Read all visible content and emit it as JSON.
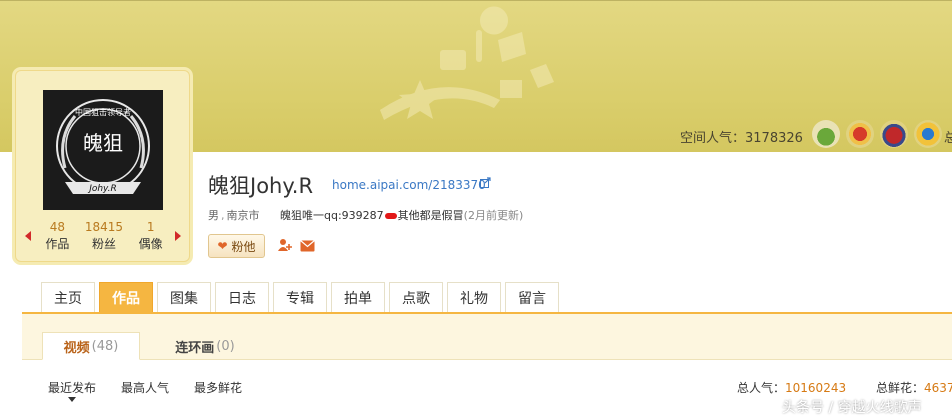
{
  "header": {
    "popularity_label": "空间人气：",
    "popularity_value": "3178326",
    "badge_more": "总",
    "badges": [
      "plant-badge-icon",
      "flame-badge-icon",
      "emblem-badge-icon",
      "star-badge-icon"
    ]
  },
  "profile": {
    "avatar": {
      "ring_text": "中国狙击领导者",
      "center_text": "魄狙",
      "ribbon_text": "Johy.R"
    },
    "stats": [
      {
        "num": "48",
        "label": "作品"
      },
      {
        "num": "18415",
        "label": "粉丝"
      },
      {
        "num": "1",
        "label": "偶像"
      }
    ],
    "name": "魄狙Johy.R",
    "link": "home.aipai.com/2183370",
    "gender": "男",
    "city": "南京市",
    "signature_start": "魄狙唯一qq:939287",
    "signature_end": "其他都是假冒",
    "updated": "(2月前更新)",
    "follow_label": "粉他"
  },
  "nav": {
    "tabs": [
      "主页",
      "作品",
      "图集",
      "日志",
      "专辑",
      "拍单",
      "点歌",
      "礼物",
      "留言"
    ],
    "active_index": 1
  },
  "subtabs": [
    {
      "label": "视频",
      "count": "(48)"
    },
    {
      "label": "连环画",
      "count": "(0)"
    }
  ],
  "sort": [
    "最近发布",
    "最高人气",
    "最多鲜花"
  ],
  "totals": {
    "popularity_label": "总人气：",
    "popularity_value": "10160243",
    "flowers_label": "总鲜花：",
    "flowers_value": "4637"
  },
  "watermark": "头条号 / 穿越火线歌声",
  "colors": {
    "accent": "#f5b641",
    "banner": "#dcd06c",
    "link": "#3a78c4",
    "number": "#d67a14"
  }
}
